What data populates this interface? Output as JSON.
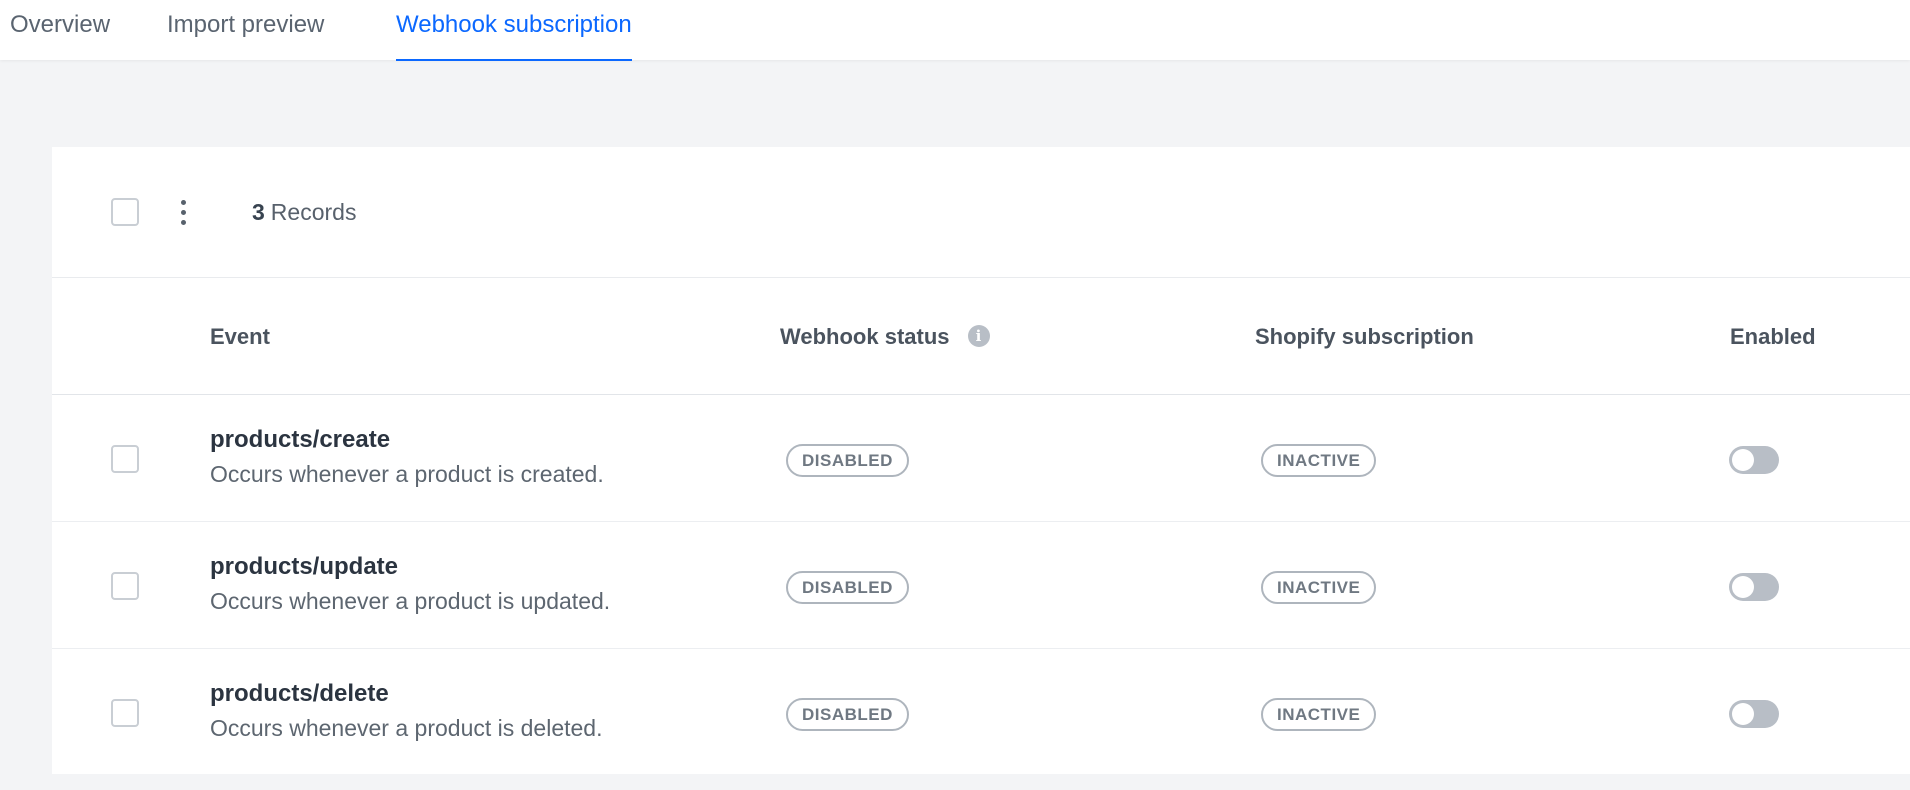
{
  "tabs": [
    {
      "label": "Overview",
      "active": false
    },
    {
      "label": "Import preview",
      "active": false
    },
    {
      "label": "Webhook subscription",
      "active": true
    }
  ],
  "accent_color": "#0b68ff",
  "toolbar": {
    "record_count": "3",
    "record_label": "Records"
  },
  "table": {
    "headers": {
      "event": "Event",
      "webhook_status": "Webhook status",
      "shopify_subscription": "Shopify subscription",
      "enabled": "Enabled"
    },
    "info_icon": "i",
    "rows": [
      {
        "name": "products/create",
        "description": "Occurs whenever a product is created.",
        "webhook_status": "DISABLED",
        "shopify_subscription": "INACTIVE",
        "enabled": false
      },
      {
        "name": "products/update",
        "description": "Occurs whenever a product is updated.",
        "webhook_status": "DISABLED",
        "shopify_subscription": "INACTIVE",
        "enabled": false
      },
      {
        "name": "products/delete",
        "description": "Occurs whenever a product is deleted.",
        "webhook_status": "DISABLED",
        "shopify_subscription": "INACTIVE",
        "enabled": false
      }
    ]
  }
}
